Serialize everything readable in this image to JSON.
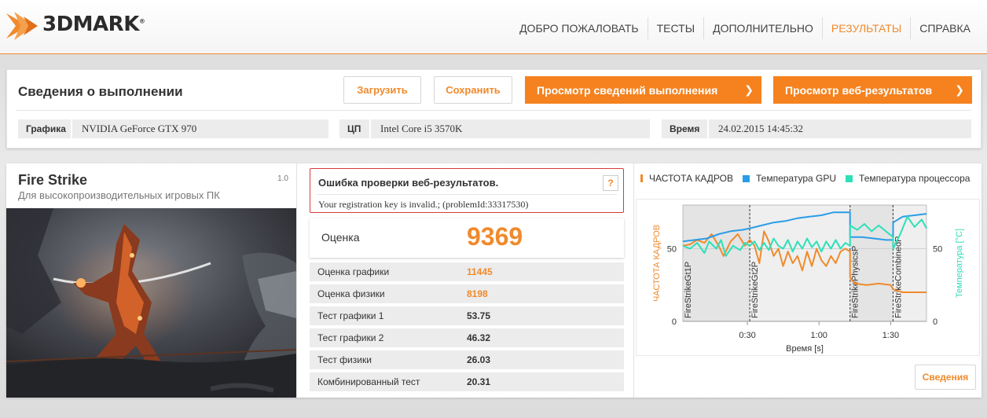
{
  "header": {
    "logo_text": "3DMARK",
    "logo_mark": "®",
    "nav": [
      {
        "label": "ДОБРО ПОЖАЛОВАТЬ",
        "active": false
      },
      {
        "label": "ТЕСТЫ",
        "active": false
      },
      {
        "label": "ДОПОЛНИТЕЛЬНО",
        "active": false
      },
      {
        "label": "РЕЗУЛЬТАТЫ",
        "active": true
      },
      {
        "label": "СПРАВКА",
        "active": false
      }
    ]
  },
  "info": {
    "title": "Сведения о выполнении",
    "load_button": "Загрузить",
    "save_button": "Сохранить",
    "view_details_button": "Просмотр сведений выполнения",
    "view_web_button": "Просмотр веб-результатов",
    "graphics_label": "Графика",
    "graphics_value": "NVIDIA GeForce GTX 970",
    "cpu_label": "ЦП",
    "cpu_value": "Intel Core i5 3570K",
    "time_label": "Время",
    "time_value": "24.02.2015 14:45:32"
  },
  "test": {
    "name": "Fire Strike",
    "version": "1.0",
    "subtitle": "Для высокопроизводительных игровых ПК"
  },
  "error": {
    "title": "Ошибка проверки веб-результатов.",
    "message": "Your registration key is invalid.; (problemId:33317530)",
    "help": "?"
  },
  "score": {
    "label": "Оценка",
    "value": "9369"
  },
  "results": [
    {
      "label": "Оценка графики",
      "value": "11445",
      "highlight": true
    },
    {
      "label": "Оценка физики",
      "value": "8198",
      "highlight": true
    },
    {
      "label": "Тест графики 1",
      "value": "53.75",
      "highlight": false
    },
    {
      "label": "Тест графики 2",
      "value": "46.32",
      "highlight": false
    },
    {
      "label": "Тест физики",
      "value": "26.03",
      "highlight": false
    },
    {
      "label": "Комбинированный тест",
      "value": "20.31",
      "highlight": false
    }
  ],
  "chart_legend": [
    {
      "label": "ЧАСТОТА КАДРОВ",
      "color": "#f08a2c"
    },
    {
      "label": "Температура GPU",
      "color": "#2a9de8"
    },
    {
      "label": "Температура процессора",
      "color": "#2de0b8"
    }
  ],
  "details_button": "Сведения",
  "chart_data": {
    "type": "line",
    "xlabel": "Время [s]",
    "ylabel_left": "ЧАСТОТА КАДРОВ",
    "ylabel_right": "Температура [°C]",
    "x_ticks": [
      "0:30",
      "1:00",
      "1:30"
    ],
    "x_tick_seconds": [
      30,
      60,
      90
    ],
    "xlim": [
      3,
      105
    ],
    "y_left_ticks": [
      "0",
      "50"
    ],
    "y_right_ticks": [
      "0",
      "50"
    ],
    "ylim_left": [
      0,
      80
    ],
    "ylim_right": [
      0,
      80
    ],
    "segments": [
      {
        "label": "FireStrikeGt1P",
        "start": 3,
        "end": 31
      },
      {
        "label": "FireStrikeGt2P",
        "start": 31,
        "end": 73
      },
      {
        "label": "FireStrikePhysicsP",
        "start": 73,
        "end": 91
      },
      {
        "label": "FireStrikeCombinedP",
        "start": 91,
        "end": 105
      }
    ],
    "series": [
      {
        "name": "ЧАСТОТА КАДРОВ",
        "color": "#f08a2c",
        "axis": "left",
        "points": [
          [
            3,
            52
          ],
          [
            6,
            53
          ],
          [
            9,
            56
          ],
          [
            12,
            54
          ],
          [
            15,
            60
          ],
          [
            18,
            52
          ],
          [
            20,
            45
          ],
          [
            23,
            55
          ],
          [
            26,
            60
          ],
          [
            29,
            52
          ],
          [
            31,
            56
          ],
          [
            33,
            52
          ],
          [
            35,
            40
          ],
          [
            37,
            62
          ],
          [
            39,
            55
          ],
          [
            41,
            45
          ],
          [
            43,
            50
          ],
          [
            45,
            38
          ],
          [
            47,
            48
          ],
          [
            49,
            40
          ],
          [
            51,
            45
          ],
          [
            53,
            35
          ],
          [
            55,
            48
          ],
          [
            57,
            38
          ],
          [
            59,
            50
          ],
          [
            61,
            42
          ],
          [
            63,
            38
          ],
          [
            65,
            45
          ],
          [
            67,
            40
          ],
          [
            69,
            48
          ],
          [
            71,
            50
          ],
          [
            73,
            48
          ],
          [
            73,
            30
          ],
          [
            75,
            26
          ],
          [
            80,
            25
          ],
          [
            85,
            26
          ],
          [
            90,
            25
          ],
          [
            91,
            22
          ],
          [
            95,
            20
          ],
          [
            100,
            20
          ],
          [
            105,
            20
          ]
        ]
      },
      {
        "name": "Температура GPU",
        "color": "#2a9de8",
        "axis": "left",
        "points": [
          [
            3,
            55
          ],
          [
            8,
            56
          ],
          [
            13,
            57
          ],
          [
            18,
            60
          ],
          [
            23,
            62
          ],
          [
            28,
            63
          ],
          [
            31,
            64
          ],
          [
            36,
            66
          ],
          [
            41,
            68
          ],
          [
            46,
            69
          ],
          [
            51,
            71
          ],
          [
            56,
            72
          ],
          [
            61,
            73
          ],
          [
            66,
            75
          ],
          [
            70,
            75
          ],
          [
            73,
            75
          ],
          [
            73,
            58
          ],
          [
            78,
            58
          ],
          [
            83,
            57
          ],
          [
            88,
            56
          ],
          [
            91,
            56
          ],
          [
            91,
            68
          ],
          [
            95,
            72
          ],
          [
            100,
            73
          ],
          [
            105,
            74
          ]
        ]
      },
      {
        "name": "Температура процессора",
        "color": "#2de0b8",
        "axis": "right",
        "points": [
          [
            3,
            52
          ],
          [
            6,
            50
          ],
          [
            9,
            54
          ],
          [
            12,
            47
          ],
          [
            14,
            55
          ],
          [
            17,
            50
          ],
          [
            19,
            56
          ],
          [
            21,
            45
          ],
          [
            24,
            52
          ],
          [
            27,
            49
          ],
          [
            29,
            54
          ],
          [
            31,
            52
          ],
          [
            33,
            55
          ],
          [
            35,
            49
          ],
          [
            37,
            54
          ],
          [
            39,
            49
          ],
          [
            41,
            57
          ],
          [
            43,
            52
          ],
          [
            45,
            50
          ],
          [
            47,
            56
          ],
          [
            49,
            48
          ],
          [
            51,
            55
          ],
          [
            53,
            50
          ],
          [
            55,
            57
          ],
          [
            57,
            51
          ],
          [
            59,
            55
          ],
          [
            61,
            48
          ],
          [
            63,
            55
          ],
          [
            65,
            50
          ],
          [
            67,
            56
          ],
          [
            69,
            50
          ],
          [
            71,
            54
          ],
          [
            73,
            52
          ],
          [
            73,
            66
          ],
          [
            76,
            63
          ],
          [
            79,
            67
          ],
          [
            82,
            62
          ],
          [
            85,
            66
          ],
          [
            88,
            62
          ],
          [
            91,
            58
          ],
          [
            91,
            50
          ],
          [
            94,
            60
          ],
          [
            97,
            72
          ],
          [
            100,
            65
          ],
          [
            103,
            70
          ],
          [
            105,
            64
          ]
        ]
      }
    ]
  }
}
